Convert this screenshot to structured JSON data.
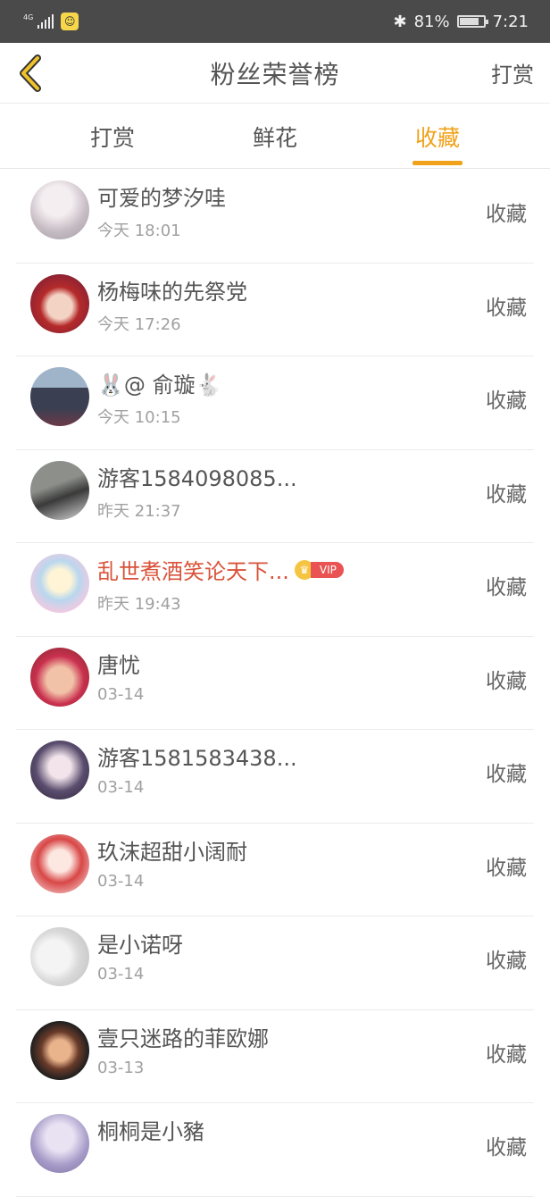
{
  "status_bar": {
    "network": "4G",
    "bluetooth_icon": "bluetooth-icon",
    "battery_percent": "81%",
    "battery_level": 0.81,
    "time": "7:21"
  },
  "header": {
    "title": "粉丝荣誉榜",
    "right_action": "打赏",
    "back_icon": "chevron-left-icon",
    "accent_color": "#f0c22a"
  },
  "tabs": [
    {
      "label": "打赏",
      "active": false
    },
    {
      "label": "鲜花",
      "active": false
    },
    {
      "label": "收藏",
      "active": true
    }
  ],
  "colors": {
    "tab_active": "#f0a21a",
    "vip_name": "#d9533a",
    "vip_tag": "#e95353"
  },
  "entries": [
    {
      "name": "可爱的梦汐哇",
      "time": "今天 18:01",
      "action": "收藏",
      "vip": false
    },
    {
      "name": "杨梅味的先祭党",
      "time": "今天 17:26",
      "action": "收藏",
      "vip": false
    },
    {
      "name": "🐰@ 俞璇🐇",
      "time": "今天 10:15",
      "action": "收藏",
      "vip": false
    },
    {
      "name": "游客1584098085...",
      "time": "昨天 21:37",
      "action": "收藏",
      "vip": false
    },
    {
      "name": "乱世煮酒笑论天下...",
      "time": "昨天 19:43",
      "action": "收藏",
      "vip": true,
      "vip_label": "VIP"
    },
    {
      "name": "唐忧",
      "time": "03-14",
      "action": "收藏",
      "vip": false
    },
    {
      "name": "游客1581583438...",
      "time": "03-14",
      "action": "收藏",
      "vip": false
    },
    {
      "name": "玖沫超甜小阔耐",
      "time": "03-14",
      "action": "收藏",
      "vip": false
    },
    {
      "name": "是小诺呀",
      "time": "03-14",
      "action": "收藏",
      "vip": false
    },
    {
      "name": "壹只迷路的菲欧娜",
      "time": "03-13",
      "action": "收藏",
      "vip": false
    },
    {
      "name": "桐桐是小豬",
      "time": "",
      "action": "收藏",
      "vip": false
    }
  ]
}
